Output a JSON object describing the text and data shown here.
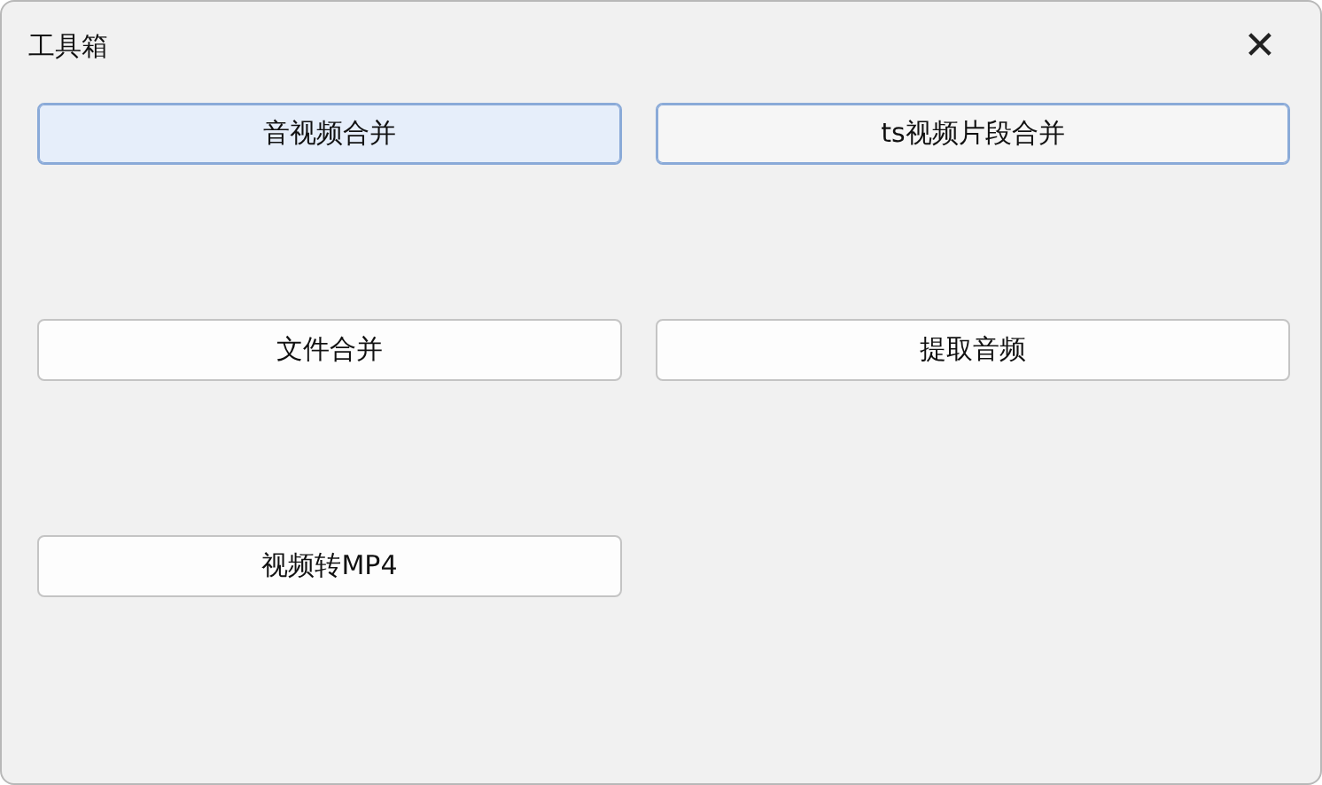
{
  "window": {
    "title": "工具箱",
    "close": "✕"
  },
  "buttons": [
    {
      "label": "音视频合并",
      "highlighted": true,
      "focused": true
    },
    {
      "label": "ts视频片段合并",
      "highlighted": false,
      "focused": true
    },
    {
      "label": "文件合并",
      "highlighted": false,
      "focused": false
    },
    {
      "label": "提取音频",
      "highlighted": false,
      "focused": false
    },
    {
      "label": "视频转MP4",
      "highlighted": false,
      "focused": false
    }
  ]
}
